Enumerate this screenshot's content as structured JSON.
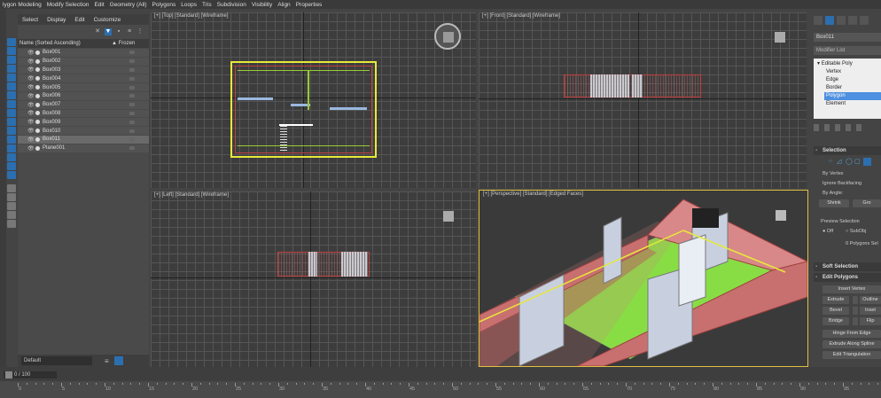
{
  "ribbon": {
    "items": [
      "lygon Modeling",
      "Modify Selection",
      "Edit",
      "Geometry (All)",
      "Polygons",
      "Loops",
      "Tris",
      "Subdivision",
      "Visibility",
      "Align",
      "Properties"
    ]
  },
  "explorer": {
    "menu": [
      "Select",
      "Display",
      "Edit",
      "Customize"
    ],
    "header_name": "Name (Sorted Ascending)",
    "header_frozen": "▲ Frozen",
    "rows": [
      "Box001",
      "Box002",
      "Box003",
      "Box004",
      "Box005",
      "Box006",
      "Box007",
      "Box008",
      "Box009",
      "Box010",
      "Box011",
      "Plane001"
    ],
    "selected_row": "Box011",
    "layer": "Default"
  },
  "viewports": {
    "top": "[+] [Top] [Standard] [Wireframe]",
    "front": "[+] [Front] [Standard] [Wireframe]",
    "left": "[+] [Left] [Standard] [Wireframe]",
    "perspective": "[+] [Perspective] [Standard] [Edged Faces]"
  },
  "command_panel": {
    "object_name": "Box011",
    "modifier_list": "Modifier List",
    "stack": {
      "root": "Editable Poly",
      "items": [
        "Vertex",
        "Edge",
        "Border",
        "Polygon",
        "Element"
      ],
      "selected": "Polygon"
    },
    "selection": {
      "title": "Selection",
      "by_vertex": "By Vertex",
      "ignore_backfacing": "Ignore Backfacing",
      "by_angle": "By Angle:",
      "shrink": "Shrink",
      "grow": "Gro",
      "preview": "Preview Selection",
      "off": "Off",
      "subobj": "SubObj",
      "status": "0 Polygons Sel"
    },
    "soft_selection": "Soft Selection",
    "edit_polygons": {
      "title": "Edit Polygons",
      "insert_vertex": "Insert Vertex",
      "extrude": "Extrude",
      "outline": "Outline",
      "bevel": "Bevel",
      "inset": "Inset",
      "bridge": "Bridge",
      "flip": "Flip",
      "hinge": "Hinge From Edge",
      "extrude_spline": "Extrude Along Spline",
      "edit_tri": "Edit Triangulation"
    }
  },
  "timeline": {
    "frame": "0 / 100",
    "ticks": [
      "0",
      "5",
      "10",
      "15",
      "20",
      "25",
      "30",
      "35",
      "40",
      "45",
      "50",
      "55",
      "60",
      "65",
      "70",
      "75",
      "80",
      "85",
      "90",
      "95"
    ]
  },
  "colors": {
    "accent": "#2c6fb0",
    "selected_stack": "#4d8fe0",
    "walls": "#c87070",
    "floor": "#88dd44",
    "selection_box": "#e8e83a"
  }
}
